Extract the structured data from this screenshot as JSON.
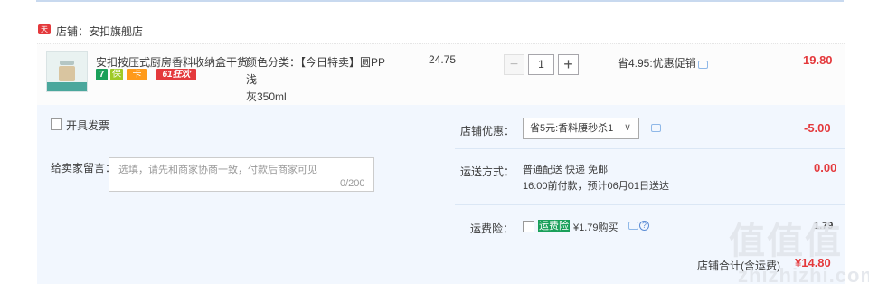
{
  "shop": {
    "badge": "天猫",
    "label": "店铺：安扣旗舰店"
  },
  "item": {
    "title": "安扣按压式厨房香料收纳盒干货...",
    "service_tags": [
      "7",
      "保",
      "卡",
      "61狂欢"
    ],
    "sku_line1": "颜色分类：【今日特卖】圆PP浅",
    "sku_line2": "灰350ml",
    "unit_price": "24.75",
    "quantity": "1",
    "minus": "−",
    "plus": "+",
    "promo": "省4.95:优惠促销",
    "total": "19.80"
  },
  "options": {
    "invoice_label": "开具发票",
    "message_label": "给卖家留言：",
    "message_placeholder": "选填，请先和商家协商一致，付款后商家可见",
    "message_count": "0/200",
    "coupon_label": "店铺优惠：",
    "coupon_value": "省5元:香料腰秒杀1",
    "coupon_chevron": "∨",
    "coupon_amount": "-5.00",
    "shipping_label": "运送方式：",
    "shipping_line1": "普通配送 快递 免邮",
    "shipping_line2": "16:00前付款，预计06月01日送达",
    "shipping_amount": "0.00",
    "insurance_label": "运费险：",
    "insurance_badge": "运费险",
    "insurance_price": "¥1.79购买",
    "insurance_help": "?",
    "insurance_amount": "1.79",
    "subtotal_label": "店铺合计(含运费)",
    "subtotal_amount": "¥14.80"
  },
  "watermark": {
    "text": "值值值",
    "url": "zhizhizhi.com"
  },
  "colors": {
    "accent_red": "#e4393c",
    "panel_blue": "#f2f7fe",
    "green": "#1aa05a"
  }
}
